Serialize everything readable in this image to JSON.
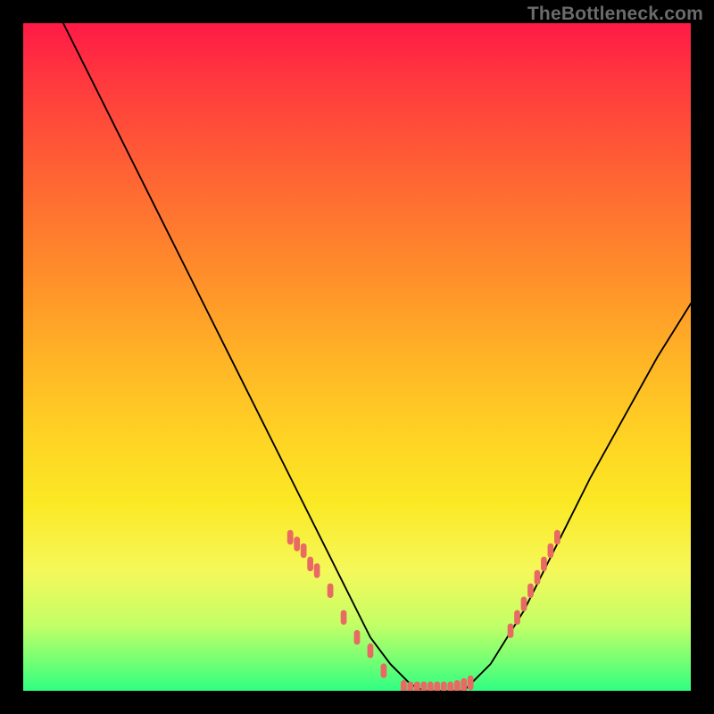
{
  "watermark": "TheBottleneck.com",
  "chart_data": {
    "type": "line",
    "title": "",
    "xlabel": "",
    "ylabel": "",
    "xlim": [
      0,
      100
    ],
    "ylim": [
      0,
      100
    ],
    "grid": false,
    "legend": false,
    "series": [
      {
        "name": "curve",
        "color": "#000000",
        "x": [
          6,
          10,
          15,
          20,
          25,
          30,
          35,
          40,
          45,
          47,
          50,
          52,
          55,
          58,
          60,
          62,
          64,
          66,
          70,
          75,
          80,
          85,
          90,
          95,
          100
        ],
        "values": [
          100,
          92,
          82,
          72,
          62,
          52,
          42,
          32,
          22,
          18,
          12,
          8,
          4,
          1,
          0,
          0,
          0,
          0,
          4,
          12,
          22,
          32,
          41,
          50,
          58
        ]
      }
    ],
    "markers": [
      {
        "name": "ticks-left",
        "color": "#e86a63",
        "shape": "tick",
        "x": [
          40,
          41,
          42,
          43,
          44,
          46,
          48,
          50,
          52,
          54
        ],
        "values": [
          23,
          22,
          21,
          19,
          18,
          15,
          11,
          8,
          6,
          3
        ]
      },
      {
        "name": "ticks-bottom",
        "color": "#e86a63",
        "shape": "tick",
        "x": [
          57,
          58,
          59,
          60,
          61,
          62,
          63,
          64,
          65,
          66,
          67
        ],
        "values": [
          0.5,
          0.3,
          0.3,
          0.3,
          0.3,
          0.3,
          0.3,
          0.3,
          0.5,
          0.8,
          1.2
        ]
      },
      {
        "name": "ticks-right",
        "color": "#e86a63",
        "shape": "tick",
        "x": [
          73,
          74,
          75,
          76,
          77,
          78,
          79,
          80
        ],
        "values": [
          9,
          11,
          13,
          15,
          17,
          19,
          21,
          23
        ]
      }
    ]
  }
}
